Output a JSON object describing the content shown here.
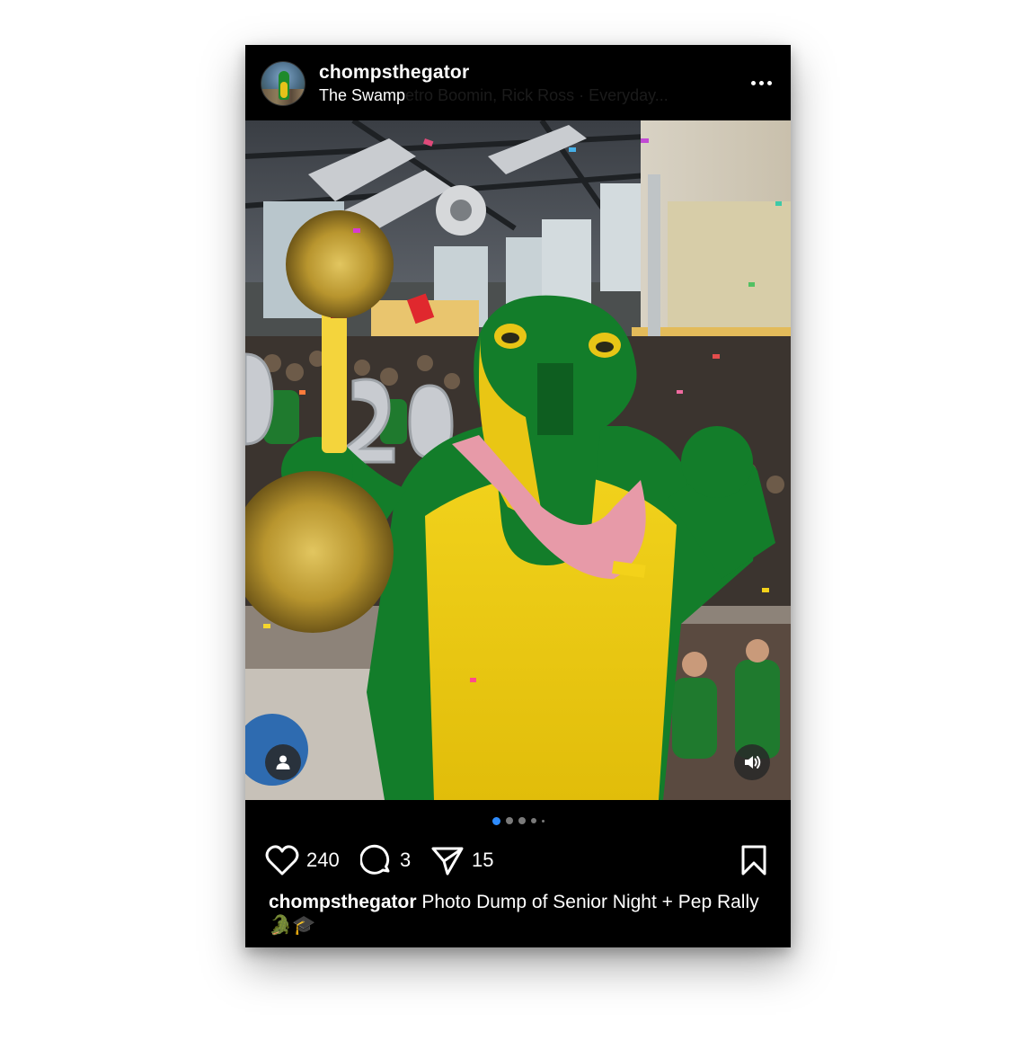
{
  "post": {
    "username": "chompsthegator",
    "location": "The Swamp",
    "song": "etro Boomin, Rick Ross · Everyday...",
    "media": {
      "image_description": "Green and yellow gator mascot holding gold pom-poms in a gym full of confetti",
      "slide_count": 5,
      "active_slide": 1
    },
    "stats": {
      "likes": "240",
      "comments": "3",
      "shares": "15"
    },
    "caption": {
      "username": "chompsthegator",
      "text": " Photo Dump of Senior Night + Pep Rally🐊🎓"
    }
  },
  "icons": {
    "more": "more-horizontal-icon",
    "tag": "user-tag-icon",
    "audio": "speaker-on-icon",
    "like": "heart-icon",
    "comment": "comment-bubble-icon",
    "share": "paper-plane-icon",
    "save": "bookmark-icon"
  },
  "colors": {
    "background": "#000000",
    "text": "#ffffff",
    "active_dot": "#2e8cff",
    "inactive_dot": "#7a7a7a"
  }
}
